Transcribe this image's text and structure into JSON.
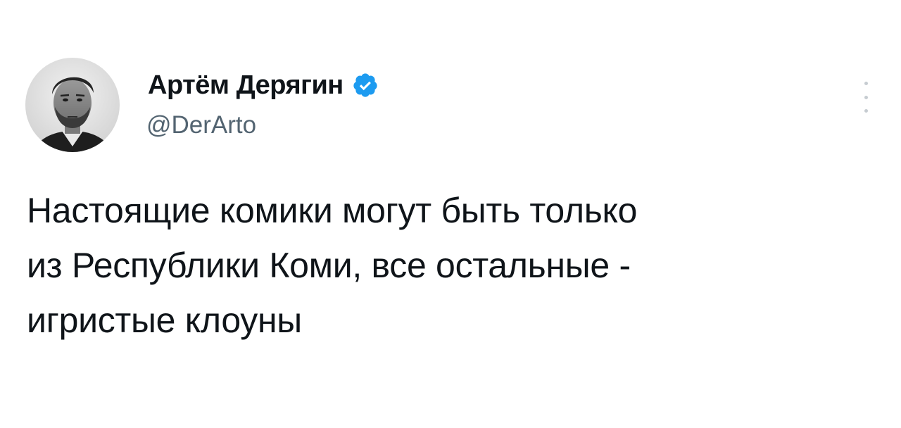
{
  "author": {
    "display_name": "Артём Дерягин",
    "handle": "@DerArto",
    "verified": true,
    "avatar": "user-avatar-photo"
  },
  "menu": {
    "icon": "more-vertical-icon"
  },
  "tweet": {
    "lines": [
      "Настоящие комики могут быть только",
      "из Республики Коми, все остальные -",
      "игристые клоуны"
    ]
  },
  "colors": {
    "text_primary": "#0f1419",
    "text_secondary": "#536471",
    "verified_blue": "#1d9bf0",
    "background": "#ffffff"
  }
}
